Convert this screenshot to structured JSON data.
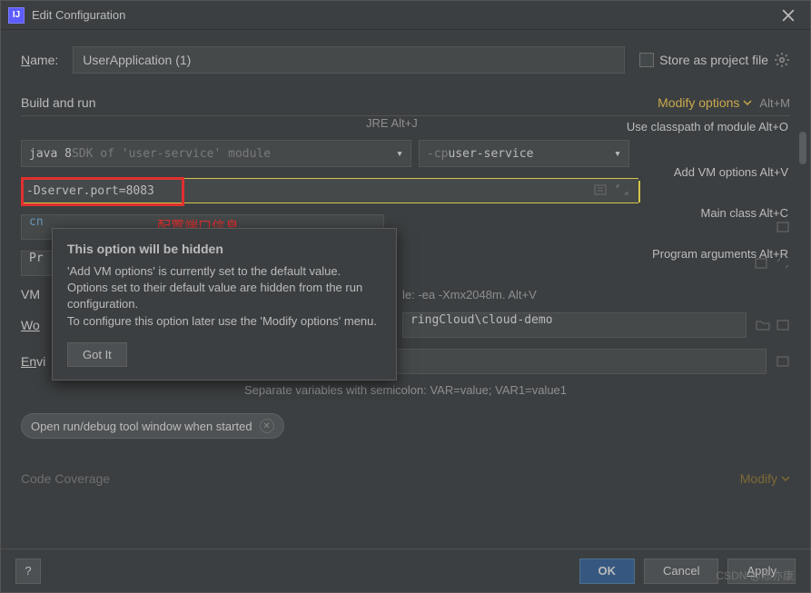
{
  "titlebar": {
    "title": "Edit Configuration"
  },
  "name": {
    "label_prefix": "N",
    "label_suffix": "ame:",
    "value": "UserApplication (1)"
  },
  "store_file": {
    "label_prefix": "S",
    "label_suffix": "tore as project file"
  },
  "build_run": {
    "title": "Build and run",
    "modify": "Modify options",
    "modify_shortcut": "Alt+M",
    "jre_hint": "JRE Alt+J",
    "jre_value": "java 8 ",
    "jre_suffix": "SDK of 'user-service' module",
    "cp_prefix": "-cp ",
    "cp_value": "user-service"
  },
  "hints": {
    "classpath": "Use classpath of module Alt+O",
    "vm": "Add VM options Alt+V",
    "main": "Main class Alt+C",
    "args": "Program arguments Alt+R"
  },
  "vm_options": {
    "value": "-Dserver.port=8083",
    "annotation": "配置端口信息",
    "hint_label": "VM",
    "hint_text": "le: -ea -Xmx2048m. Alt+V"
  },
  "masked1": {
    "label": "cn"
  },
  "masked2": {
    "label": "Pr"
  },
  "tooltip": {
    "title": "This option will be hidden",
    "body": "'Add VM options' is currently set to the default value. Options set to their default value are hidden from the run configuration.\nTo configure this option later use the 'Modify options' menu.",
    "button": "Got It"
  },
  "workdir": {
    "label_prefix": "Wo",
    "value": "ringCloud\\cloud-demo"
  },
  "env": {
    "label_prefix": "En",
    "label_suffix": "vi",
    "helper": "Separate variables with semicolon: VAR=value; VAR1=value1"
  },
  "chip": {
    "label": "Open run/debug tool window when started"
  },
  "coverage": {
    "label": "Code Coverage",
    "modify": "Modify"
  },
  "footer": {
    "help": "?",
    "ok": "OK",
    "cancel": "Cancel",
    "apply_prefix": "A",
    "apply_suffix": "pply"
  },
  "watermark": "CSDN @陈亦康"
}
